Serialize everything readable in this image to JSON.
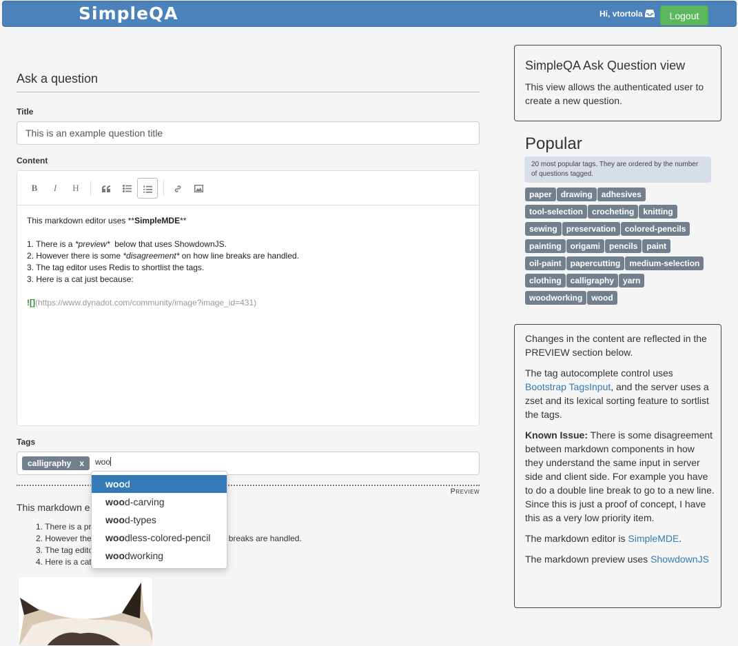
{
  "navbar": {
    "brand": "SimpleQA",
    "greeting": "Hi, vtortola",
    "logout_label": "Logout"
  },
  "form": {
    "heading": "Ask a question",
    "title_label": "Title",
    "title_value": "This is an example question title",
    "content_label": "Content",
    "tags_label": "Tags",
    "tag_selected": "calligraphy",
    "tag_remove": "x",
    "tag_typed": "woo"
  },
  "toolbar": {
    "bold": "B",
    "italic": "I",
    "heading": "H",
    "icons": [
      "bold-icon",
      "italic-icon",
      "heading-icon",
      "quote-icon",
      "unordered-list-icon",
      "ordered-list-icon",
      "link-icon",
      "image-icon"
    ]
  },
  "editor": {
    "l1_pre": "This markdown editor uses **",
    "l1_bold": "SimpleMDE",
    "l1_post": "**",
    "l2_pre": "1. There is a ",
    "l2_em": "*preview*",
    "l2_post": "  below that uses ShowdownJS.",
    "l3_pre": "2. However there is some ",
    "l3_em": "*disagreement*",
    "l3_post": " on how line breaks are handled.",
    "l4": "3. The tag editor uses Redis to shortlist the tags.",
    "l5": "3. Here is a cat just because:",
    "l6_bang": "![]",
    "l6_link": "(https://www.dynadot.com/community/image?image_id=431)"
  },
  "autocomplete": {
    "match": "woo",
    "items": [
      {
        "rest": "d",
        "active": true
      },
      {
        "rest": "d-carving"
      },
      {
        "rest": "d-types"
      },
      {
        "rest": "dless-colored-pencil"
      },
      {
        "rest": "dworking"
      }
    ]
  },
  "preview": {
    "label": "Preview",
    "title_visible": "This markdown e",
    "item1_visible": "1. There is a pr",
    "item1_tail": ".",
    "item2_visible": "2. However the",
    "item2_tail": "e breaks are handled.",
    "item3_visible": "3. The tag edito",
    "item4_visible": "4. Here is a cat"
  },
  "sidebar": {
    "panel1_title": "SimpleQA Ask Question view",
    "panel1_text": "This view allows the authenticated user to create a new question.",
    "popular_title": "Popular",
    "popular_note": "20 most popular tags. They are ordered by the number of questions tagged.",
    "tags": [
      [
        "paper",
        "drawing",
        "adhesives"
      ],
      [
        "tool-selection",
        "crocheting",
        "knitting"
      ],
      [
        "sewing",
        "preservation",
        "colored-pencils"
      ],
      [
        "painting",
        "origami",
        "pencils",
        "paint"
      ],
      [
        "oil-paint",
        "papercutting",
        "medium-selection"
      ],
      [
        "clothing",
        "calligraphy",
        "yarn"
      ],
      [
        "woodworking",
        "wood"
      ]
    ],
    "p2_para1": "Changes in the content are reflected in the PREVIEW section below.",
    "p2_para2_pre": "The tag autocomplete control uses ",
    "p2_para2_link": "Bootstrap TagsInput",
    "p2_para2_post": ", and the server uses a zset and its lexical sorting feature to sortlist the tags.",
    "p2_para3_bold": "Known Issue:",
    "p2_para3_text": " There is some disagreement between markdown components in how they understand the same input in server side and client side. For example you have to do a double line break to go to a new line. Since this is just a proof of concept, I have this as a very low priority item.",
    "p2_para4_pre": "The markdown editor is ",
    "p2_para4_link": "SimpleMDE",
    "p2_para4_post": ".",
    "p2_para5_pre": "The markdown preview uses ",
    "p2_para5_link": "ShowdownJS"
  }
}
